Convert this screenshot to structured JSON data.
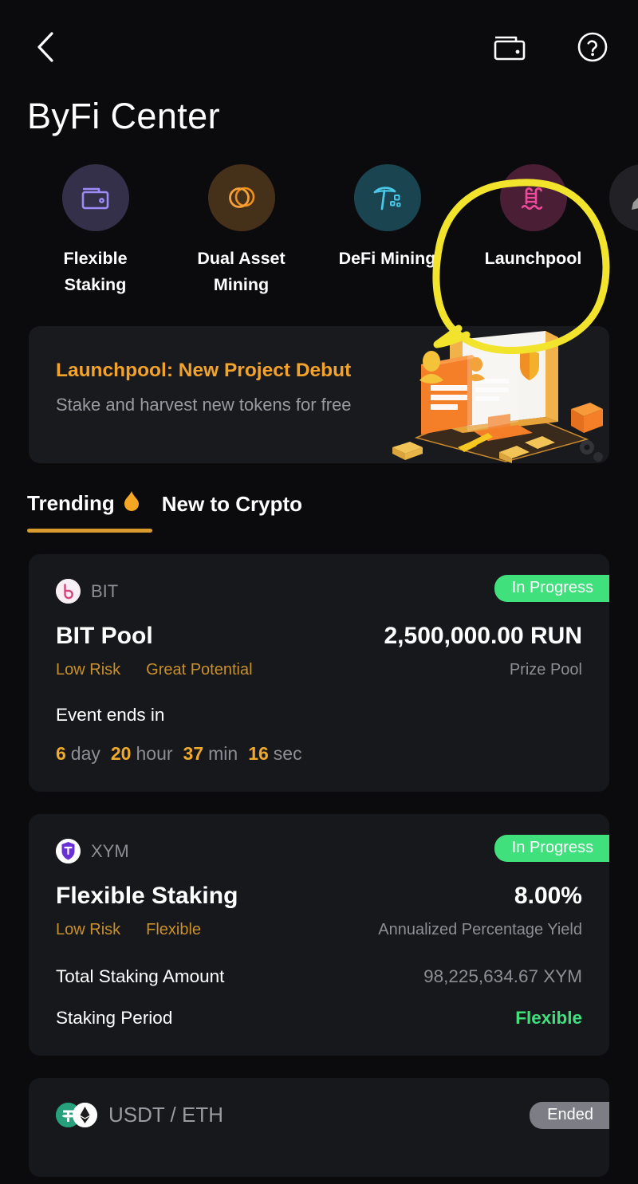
{
  "header": {
    "back_icon": "chevron-left-icon",
    "wallet_icon": "wallet-icon",
    "help_icon": "help-circle-icon",
    "title": "ByFi Center"
  },
  "categories": [
    {
      "label": "Flexible\nStaking",
      "icon": "wallet-icon",
      "bg": "#34304a",
      "fg": "#9b8cf5"
    },
    {
      "label": "Dual Asset\nMining",
      "icon": "dual-circles-icon",
      "bg": "#45301a",
      "fg": "#f0901e"
    },
    {
      "label": "DeFi Mining",
      "icon": "pickaxe-icon",
      "bg": "#1a4450",
      "fg": "#4ac8e8"
    },
    {
      "label": "Launchpool",
      "icon": "pool-ladder-icon",
      "bg": "#4a1f35",
      "fg": "#ef4a9b"
    }
  ],
  "category_partial": {
    "icon": "pen-icon",
    "bg": "#222226",
    "fg": "#9b9b9b"
  },
  "annotation": {
    "type": "hand-drawn-circle",
    "color": "#f2e32c",
    "target": "Launchpool"
  },
  "banner": {
    "title": "Launchpool: New Project Debut",
    "subtitle": "Stake and harvest new tokens for free",
    "title_color": "#f3a32a",
    "art": "3d-monitor-documents-illustration"
  },
  "tabs": [
    {
      "label": "Trending",
      "icon": "flame-icon",
      "active": true
    },
    {
      "label": "New to Crypto",
      "icon": "",
      "active": false
    }
  ],
  "tab_accent": "#d99b2d",
  "cards": [
    {
      "symbol": "BIT",
      "logos": [
        "bit-logo"
      ],
      "status": {
        "label": "In Progress",
        "color": "#40e07d"
      },
      "name": "BIT Pool",
      "value": "2,500,000.00 RUN",
      "tags": [
        "Low Risk",
        "Great Potential"
      ],
      "value_caption": "Prize Pool",
      "countdown_label": "Event ends in",
      "countdown": [
        {
          "num": "6",
          "unit": "day"
        },
        {
          "num": "20",
          "unit": "hour"
        },
        {
          "num": "37",
          "unit": "min"
        },
        {
          "num": "16",
          "unit": "sec"
        }
      ],
      "rows": []
    },
    {
      "symbol": "XYM",
      "logos": [
        "xym-logo"
      ],
      "status": {
        "label": "In Progress",
        "color": "#40e07d"
      },
      "name": "Flexible Staking",
      "value": "8.00%",
      "tags": [
        "Low Risk",
        "Flexible"
      ],
      "value_caption": "Annualized Percentage Yield",
      "rows": [
        {
          "key": "Total Staking Amount",
          "val": "98,225,634.67 XYM",
          "accent": false
        },
        {
          "key": "Staking Period",
          "val": "Flexible",
          "accent": true
        }
      ]
    },
    {
      "symbol": "USDT / ETH",
      "logos": [
        "usdt-logo",
        "eth-logo"
      ],
      "status": {
        "label": "Ended",
        "color": "#7d7d85"
      },
      "name": "",
      "value": "",
      "tags": [],
      "value_caption": "",
      "rows": []
    }
  ]
}
